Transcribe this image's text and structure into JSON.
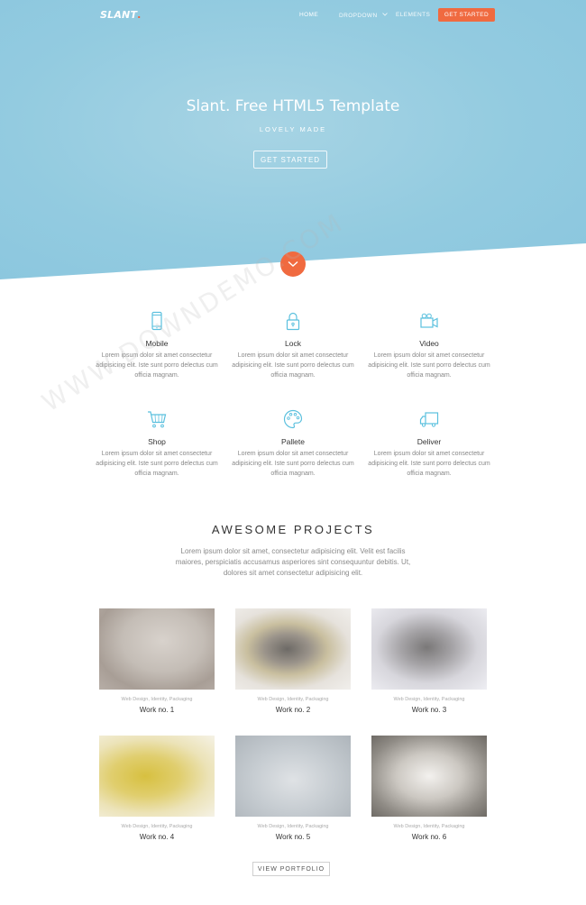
{
  "nav": {
    "brand": "SLANT",
    "brand_dot": ".",
    "items": [
      "HOME",
      "DROPDOWN",
      "ELEMENTS"
    ],
    "cta": "GET STARTED"
  },
  "hero": {
    "title": "Slant. Free HTML5 Template",
    "subtitle": "LOVELY MADE",
    "button": "GET STARTED"
  },
  "features": [
    {
      "icon": "mobile-icon",
      "title": "Mobile",
      "text": "Lorem ipsum dolor sit amet consectetur adipisicing elit. Iste sunt porro delectus cum officia magnam."
    },
    {
      "icon": "lock-icon",
      "title": "Lock",
      "text": "Lorem ipsum dolor sit amet consectetur adipisicing elit. Iste sunt porro delectus cum officia magnam."
    },
    {
      "icon": "video-icon",
      "title": "Video",
      "text": "Lorem ipsum dolor sit amet consectetur adipisicing elit. Iste sunt porro delectus cum officia magnam."
    },
    {
      "icon": "cart-icon",
      "title": "Shop",
      "text": "Lorem ipsum dolor sit amet consectetur adipisicing elit. Iste sunt porro delectus cum officia magnam."
    },
    {
      "icon": "palette-icon",
      "title": "Pallete",
      "text": "Lorem ipsum dolor sit amet consectetur adipisicing elit. Iste sunt porro delectus cum officia magnam."
    },
    {
      "icon": "truck-icon",
      "title": "Deliver",
      "text": "Lorem ipsum dolor sit amet consectetur adipisicing elit. Iste sunt porro delectus cum officia magnam."
    }
  ],
  "projects": {
    "title": "AWESOME PROJECTS",
    "description": "Lorem ipsum dolor sit amet, consectetur adipisicing elit. Velit est facilis maiores, perspiciatis accusamus asperiores sint consequuntur debitis. Ut, dolores sit amet consectetur adipisicing elit.",
    "works": [
      {
        "category": "Web Design, Identity, Packaging",
        "title": "Work no. 1"
      },
      {
        "category": "Web Design, Identity, Packaging",
        "title": "Work no. 2"
      },
      {
        "category": "Web Design, Identity, Packaging",
        "title": "Work no. 3"
      },
      {
        "category": "Web Design, Identity, Packaging",
        "title": "Work no. 4"
      },
      {
        "category": "Web Design, Identity, Packaging",
        "title": "Work no. 5"
      },
      {
        "category": "Web Design, Identity, Packaging",
        "title": "Work no. 6"
      }
    ],
    "button": "VIEW PORTFOLIO"
  },
  "watermark": "WWW.DOWNDEMO.COM",
  "colors": {
    "accent": "#f06a40",
    "hero_blue": "#93cbe0",
    "icon_blue": "#5bc0de"
  }
}
